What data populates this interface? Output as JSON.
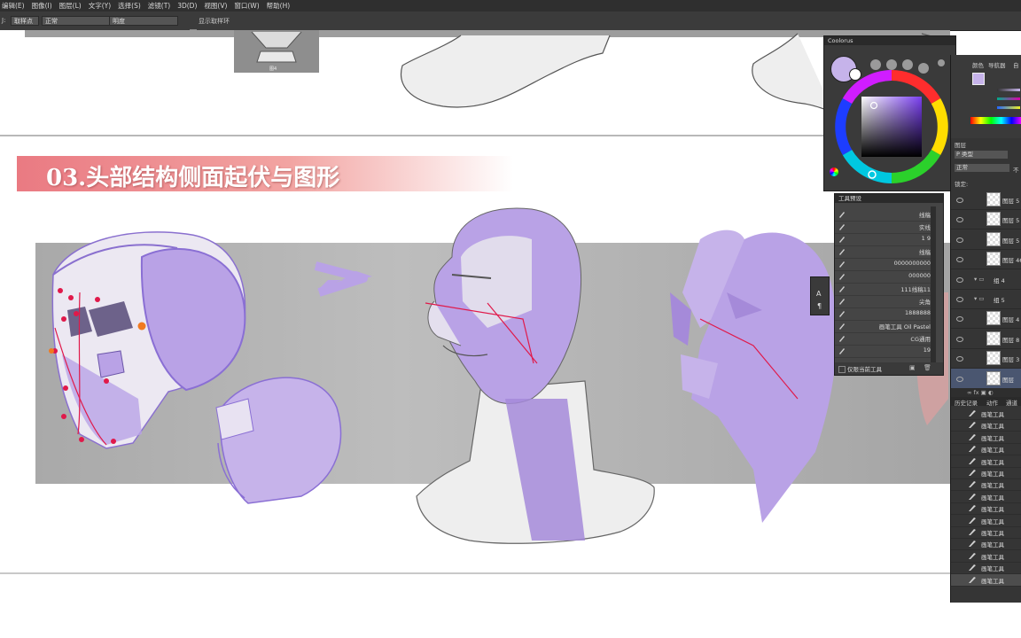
{
  "menu": [
    "编辑(E)",
    "图像(I)",
    "图层(L)",
    "文字(Y)",
    "选择(S)",
    "滤镜(T)",
    "3D(D)",
    "视图(V)",
    "窗口(W)",
    "帮助(H)"
  ],
  "options": {
    "label1": "J:",
    "field1": "取样点",
    "field2": "正常",
    "field3": "明度",
    "checkbox_label": "显示取样环"
  },
  "canvas": {
    "title": "03.头部结构侧面起伏与图形",
    "small_label": "图4"
  },
  "coolorus": {
    "title": "Coolorus",
    "current_color": "#c6b3ea"
  },
  "tool_presets": {
    "title": "工具预设",
    "rows": [
      "线稿",
      "实线",
      "1    9",
      "线稿",
      "0000000000",
      "000000",
      "111线稿11",
      "尖角",
      "1888888",
      "画笔工具 Oil Pastel",
      "CG通用",
      "19"
    ],
    "footer": "仅限当前工具"
  },
  "dock": {
    "top_tabs": [
      "颜色",
      "导航器",
      "自"
    ],
    "layers_tab": "图层",
    "filter_label": "P 类型",
    "blend_mode": "正常",
    "opacity_label": "不",
    "lock_label": "锁定:",
    "layers": [
      {
        "name": "图层 5"
      },
      {
        "name": "图层 5"
      },
      {
        "name": "图层 5"
      },
      {
        "name": "图层 46"
      },
      {
        "name": "组 4"
      },
      {
        "name": "组 5"
      },
      {
        "name": "图层 4"
      },
      {
        "name": "图层 8"
      },
      {
        "name": "图层 3"
      },
      {
        "name": "图层"
      }
    ],
    "history_tabs": [
      "历史记录",
      "动作",
      "通道"
    ],
    "history_items": [
      "画笔工具",
      "画笔工具",
      "画笔工具",
      "画笔工具",
      "画笔工具",
      "画笔工具",
      "画笔工具",
      "画笔工具",
      "画笔工具",
      "画笔工具",
      "画笔工具",
      "画笔工具",
      "画笔工具",
      "画笔工具",
      "画笔工具"
    ]
  },
  "colors": {
    "purple": "#b9a2e6",
    "purple_dark": "#9a84d2",
    "banner": "#ea7a82",
    "guide_line": "#e0194a"
  }
}
